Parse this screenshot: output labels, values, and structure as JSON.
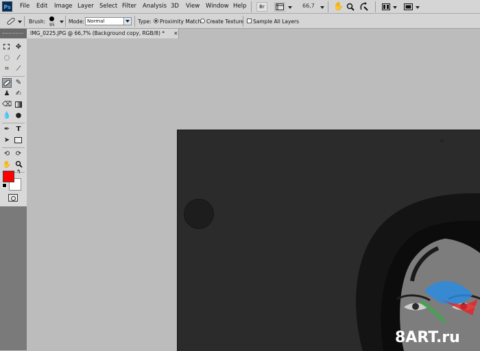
{
  "app": {
    "logo": "Ps"
  },
  "menu": [
    "File",
    "Edit",
    "Image",
    "Layer",
    "Select",
    "Filter",
    "Analysis",
    "3D",
    "View",
    "Window",
    "Help"
  ],
  "menubar": {
    "bridge_label": "Br",
    "zoom": "66,7"
  },
  "options": {
    "brush_label": "Brush:",
    "brush_size": "95",
    "mode_label": "Mode:",
    "mode_value": "Normal",
    "type_label": "Type:",
    "type_options": [
      "Proximity Match",
      "Create Texture"
    ],
    "type_selected": "Proximity Match",
    "sample_all_layers_label": "Sample All Layers",
    "sample_all_layers_checked": false
  },
  "document": {
    "tab_title": "IMG_0225.JPG @ 66,7% (Background copy, RGB/8) *",
    "close_symbol": "×"
  },
  "colors": {
    "foreground": "#ff0000",
    "background": "#ffffff"
  },
  "tools": [
    "marquee-tool",
    "move-tool",
    "lasso-tool",
    "magic-wand-tool",
    "crop-tool",
    "eyedropper-tool",
    "spot-healing-brush-tool",
    "brush-tool",
    "clone-stamp-tool",
    "history-brush-tool",
    "eraser-tool",
    "gradient-tool",
    "blur-tool",
    "dodge-tool",
    "pen-tool",
    "type-tool",
    "path-selection-tool",
    "rectangle-tool",
    "3d-rotate-tool",
    "3d-orbit-tool",
    "hand-tool",
    "zoom-tool"
  ],
  "watermark": {
    "text": "8ART.ru"
  }
}
